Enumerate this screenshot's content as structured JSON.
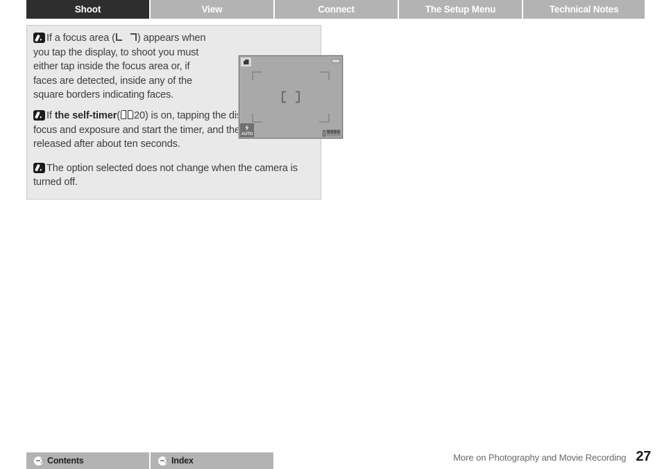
{
  "tabs": [
    {
      "label": "Shoot",
      "active": true
    },
    {
      "label": "View",
      "active": false
    },
    {
      "label": "Connect",
      "active": false
    },
    {
      "label": "The Setup Menu",
      "active": false
    },
    {
      "label": "Technical Notes",
      "active": false
    }
  ],
  "notes": {
    "note1": {
      "lead": "If a focus area (",
      "after_glyph": ") appears when you tap the display, to shoot you must either tap inside the focus area or, if faces are detected, inside any of the square borders indicating faces."
    },
    "note2": {
      "lead": "If ",
      "bold": "the self-timer",
      "paren_open": "(",
      "page_ref": "20",
      "paren_close": ") is on, tapping the display will lock focus and exposure and start the timer, and the shutter will be released after about ten seconds."
    },
    "note3": {
      "text": "The option selected does not change when the camera is turned off."
    }
  },
  "lcd": {
    "flash_mode_label": "AUTO",
    "frames_remaining": "9990"
  },
  "footer": {
    "contents_label": "Contents",
    "index_label": "Index",
    "section_label": "More on Photography and Movie Recording",
    "page_number": "27"
  },
  "colors": {
    "tab_active_bg": "#2e2e2e",
    "tab_inactive_bg": "#b3b3b3",
    "note_box_bg": "#e9e9e9",
    "note_box_border": "#c8c8c8",
    "lcd_bg": "#a9a9a9",
    "footer_button_bg": "#b3b3b3",
    "body_text": "#3d3d3d"
  }
}
